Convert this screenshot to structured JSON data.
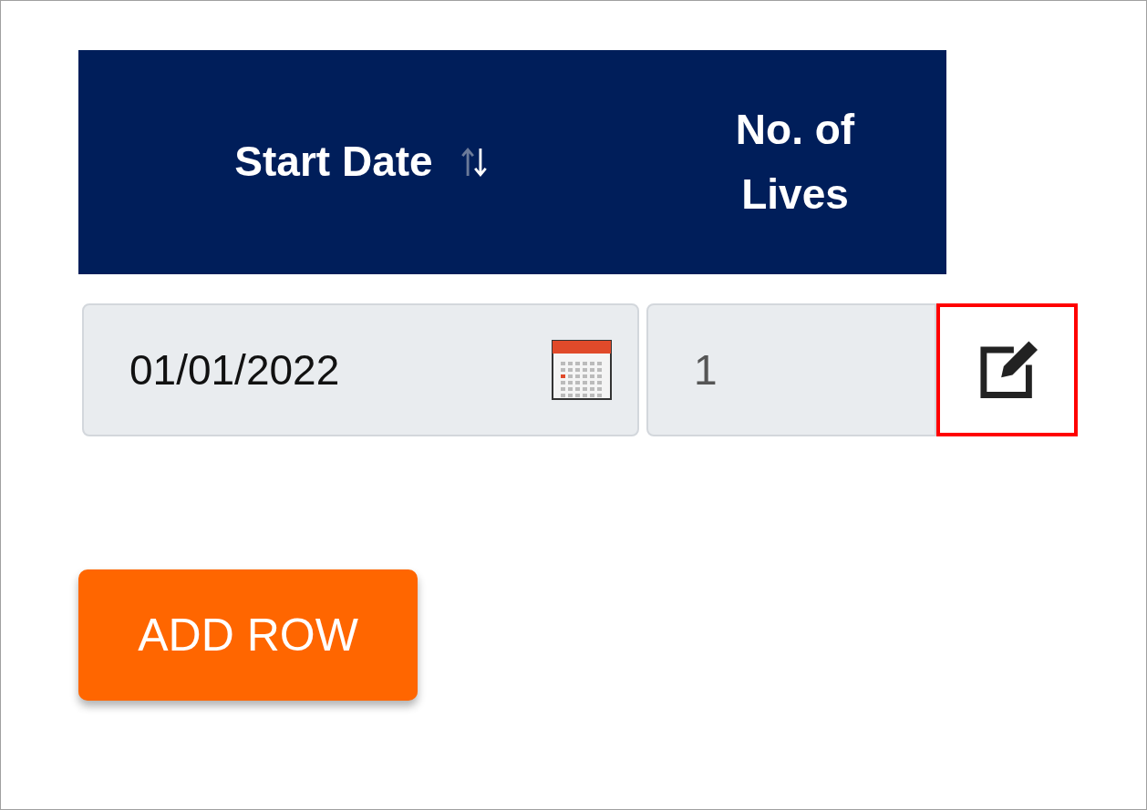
{
  "table": {
    "columns": [
      {
        "label": "Start Date",
        "sortable": true
      },
      {
        "label": "No. of Lives"
      }
    ],
    "rows": [
      {
        "start_date": "01/01/2022",
        "lives": "1",
        "edit_highlighted": true
      }
    ]
  },
  "buttons": [
    {
      "label": "ADD ROW"
    }
  ]
}
